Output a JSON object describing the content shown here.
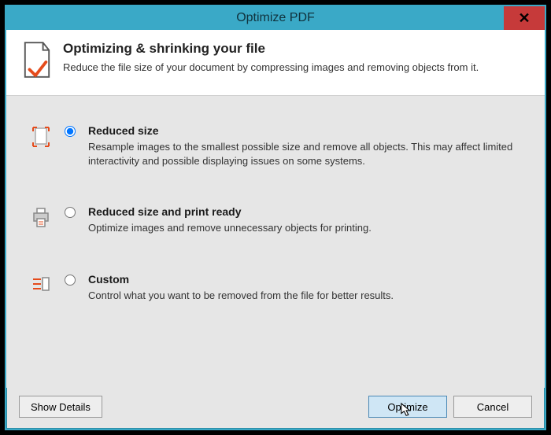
{
  "window": {
    "title": "Optimize PDF"
  },
  "header": {
    "heading": "Optimizing & shrinking your file",
    "subtext": "Reduce the file size of your document by compressing images and removing objects from it."
  },
  "options": {
    "reduced": {
      "title": "Reduced size",
      "desc": "Resample images to the smallest possible size and remove all objects. This may affect limited interactivity and possible displaying issues on some systems."
    },
    "print": {
      "title": "Reduced size and print ready",
      "desc": "Optimize images and remove unnecessary objects for printing."
    },
    "custom": {
      "title": "Custom",
      "desc": "Control what you want to be removed from the file for better results."
    }
  },
  "buttons": {
    "show_details": "Show Details",
    "optimize": "Optimize",
    "cancel": "Cancel"
  }
}
